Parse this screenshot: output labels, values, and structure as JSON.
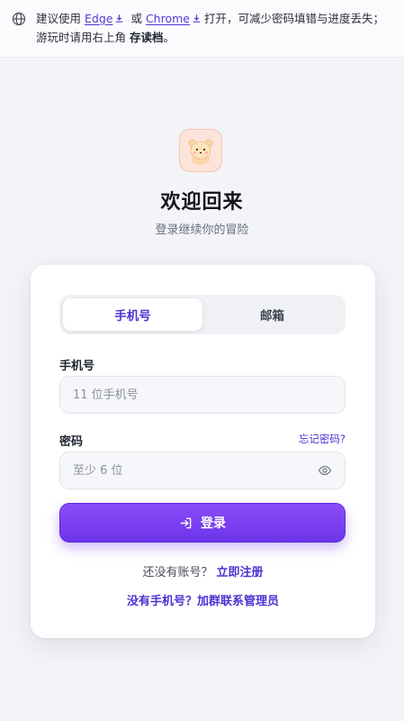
{
  "notice": {
    "prefix": "建议使用",
    "browser1": "Edge",
    "or": "或",
    "browser2": "Chrome",
    "suffix": "打开，可减少密码填错与进度丢失；游玩时请用右上角",
    "save": "存读档",
    "end": "。"
  },
  "header": {
    "title": "欢迎回来",
    "subtitle": "登录继续你的冒险"
  },
  "tabs": [
    {
      "label": "手机号",
      "active": true
    },
    {
      "label": "邮箱",
      "active": false
    }
  ],
  "form": {
    "phone_label": "手机号",
    "phone_placeholder": "11 位手机号",
    "password_label": "密码",
    "forgot_label": "忘记密码?",
    "password_placeholder": "至少 6 位",
    "submit_label": "登录"
  },
  "footer": {
    "no_account": "还没有账号？",
    "register_link": "立即注册",
    "no_phone": "没有手机号？加群联系管理员"
  },
  "colors": {
    "accent": "#4a34d2",
    "button_top": "#8b4df7",
    "button_bottom": "#6d34e9"
  }
}
